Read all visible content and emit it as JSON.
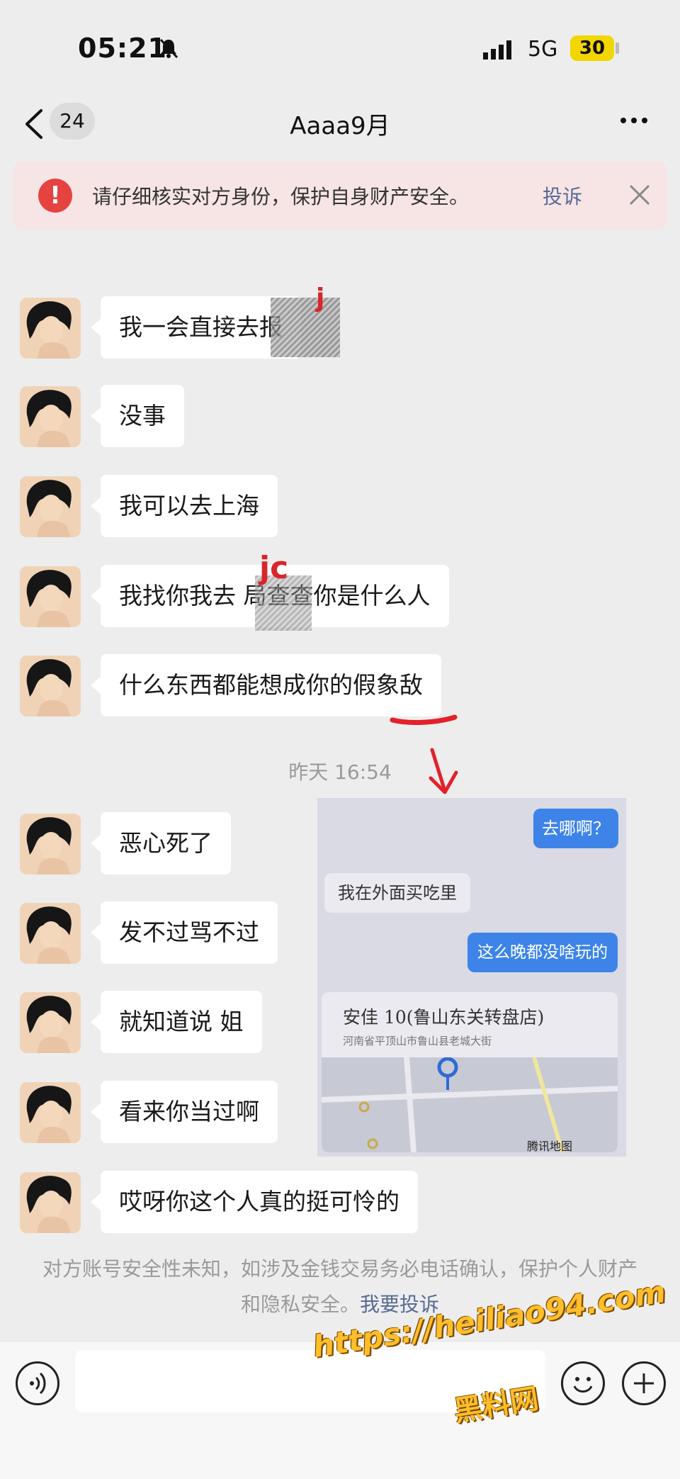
{
  "status_bar": {
    "time": "05:21",
    "network": "5G",
    "battery": "30"
  },
  "nav": {
    "unread_count": "24",
    "title": "Aaaa9月"
  },
  "warning": {
    "text": "请仔细核实对方身份，保护自身财产安全。",
    "action": "投诉"
  },
  "messages": [
    {
      "text": "我一会直接去报"
    },
    {
      "text": "没事"
    },
    {
      "text": "我可以去上海"
    },
    {
      "text": "我找你我去 局查查你是什么人"
    },
    {
      "text": "什么东西都能想成你的假象敌"
    },
    {
      "text": "恶心死了"
    },
    {
      "text": "发不过骂不过"
    },
    {
      "text": "就知道说 姐"
    },
    {
      "text": "看来你当过啊"
    },
    {
      "text": "哎呀你这个人真的挺可怜的"
    }
  ],
  "timestamp": "昨天 16:54",
  "annotations": {
    "mark_j": "j",
    "mark_jc": "jc"
  },
  "inset": {
    "bubble1": "去哪啊？",
    "bubble2": "我在外面买吃里",
    "bubble3": "这么晚都没啥玩的",
    "place": "安佳 10(鲁山东关转盘店)",
    "address": "河南省平顶山市鲁山县老城大街",
    "map_brand": "腾讯地图"
  },
  "notice": {
    "text": "对方账号安全性未知，如涉及金钱交易务必电话确认，保护个人财产和隐私安全。",
    "link": "我要投诉"
  },
  "input": {
    "placeholder": ""
  },
  "watermark": {
    "url": "https://heiliao94.com",
    "site": "黑料网"
  },
  "colors": {
    "background": "#ededed",
    "bubble": "#ffffff",
    "link": "#576b95",
    "warning_bg": "#f7e5e5",
    "warning_icon": "#e64340"
  }
}
